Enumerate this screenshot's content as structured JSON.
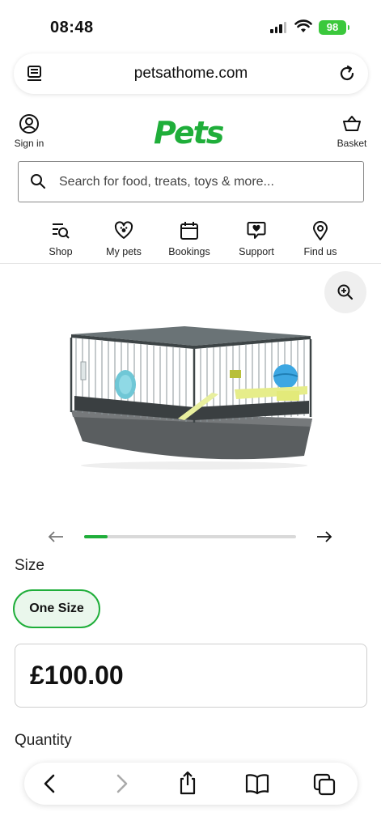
{
  "status_bar": {
    "time": "08:48",
    "battery": "98"
  },
  "browser": {
    "url": "petsathome.com"
  },
  "header": {
    "logo": "Pets",
    "sign_in": "Sign in",
    "basket": "Basket"
  },
  "search": {
    "placeholder": "Search for food, treats, toys & more..."
  },
  "nav": [
    {
      "label": "Shop",
      "icon": "shop-search-icon"
    },
    {
      "label": "My pets",
      "icon": "heart-paw-icon"
    },
    {
      "label": "Bookings",
      "icon": "calendar-icon"
    },
    {
      "label": "Support",
      "icon": "chat-heart-icon"
    },
    {
      "label": "Find us",
      "icon": "location-pin-icon"
    }
  ],
  "carousel": {
    "progress": 0.11
  },
  "product": {
    "size_label": "Size",
    "size_option": "One Size",
    "price": "£100.00",
    "quantity_label": "Quantity"
  },
  "colors": {
    "brand": "#1fae3a",
    "text": "#111111"
  }
}
